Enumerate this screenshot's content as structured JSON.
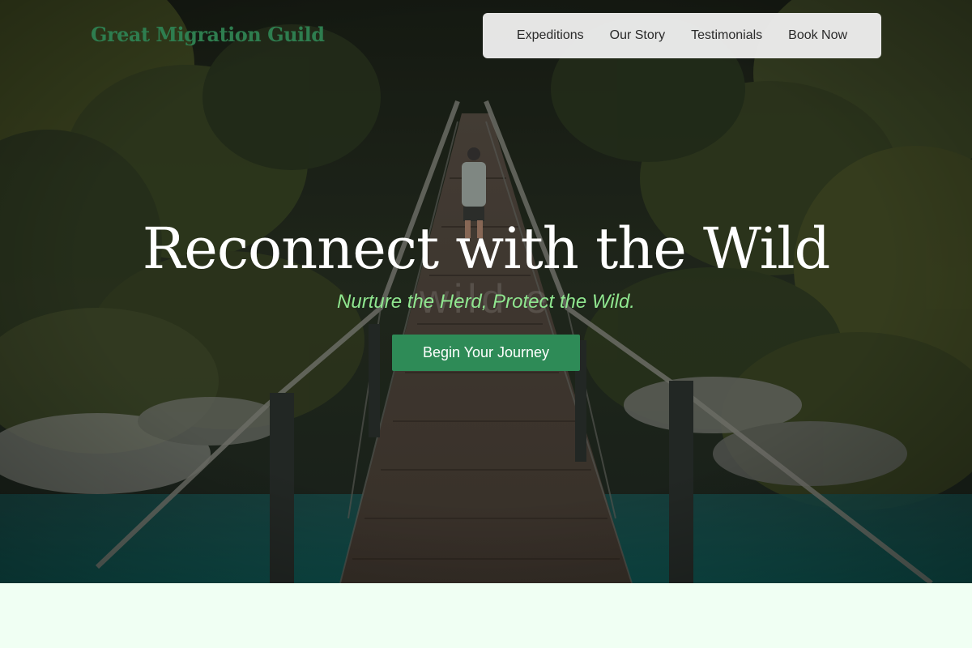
{
  "brand": {
    "name": "Great Migration Guild"
  },
  "nav": {
    "items": [
      "Expeditions",
      "Our Story",
      "Testimonials",
      "Book Now"
    ]
  },
  "hero": {
    "headline": "Reconnect with the Wild",
    "ghost_text": "wild e",
    "tagline": "Nurture the Herd, Protect the Wild.",
    "cta_label": "Begin Your Journey",
    "image": "forest-suspension-bridge-photo"
  },
  "colors": {
    "accent": "#2e8b57",
    "brand_text": "#2e7d4f",
    "tagline": "#8fe68f",
    "page_background": "#f0fff3",
    "nav_background": "#f0f0f0"
  }
}
